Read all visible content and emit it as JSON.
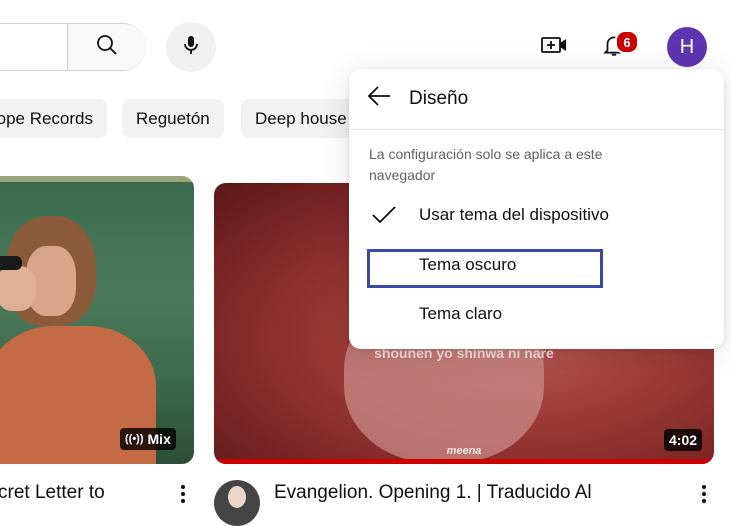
{
  "header": {
    "search_placeholder": "",
    "notification_count": "6",
    "avatar_initial": "H"
  },
  "chips": [
    {
      "label": "ope Records"
    },
    {
      "label": "Reguetón"
    },
    {
      "label": "Deep house"
    }
  ],
  "videos": [
    {
      "title": "cret Letter to",
      "badge": "Mix"
    },
    {
      "title": "Evangelion. Opening 1. | Traducido Al",
      "duration": "4:02",
      "subtitle": "shounen yo shinwa ni nare",
      "watermark": "meena"
    }
  ],
  "menu": {
    "title": "Diseño",
    "note": "La configuración solo se aplica a este navegador",
    "items": [
      {
        "label": "Usar tema del dispositivo",
        "selected": true
      },
      {
        "label": "Tema oscuro",
        "selected": false
      },
      {
        "label": "Tema claro",
        "selected": false
      }
    ]
  },
  "colors": {
    "avatar_bg": "#5e35b1",
    "badge_red": "#cc0000",
    "focus_ring": "#3c48a6"
  }
}
